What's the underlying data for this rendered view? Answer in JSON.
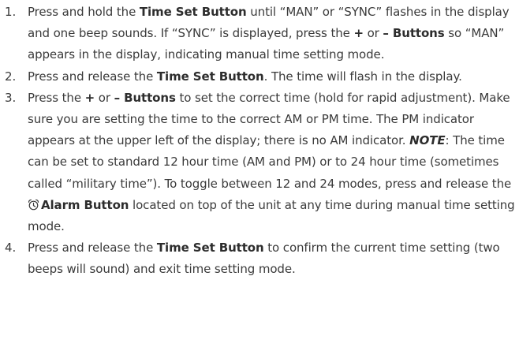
{
  "steps": [
    {
      "number": "1.",
      "parts": [
        "Press and hold the ",
        "Time Set Button",
        " until “MAN” or “SYNC” flashes in the display and one beep sounds. If “SYNC” is displayed, press the ",
        "+",
        " or ",
        "– Buttons",
        " so “MAN” appears in the display, indicating manual time setting mode."
      ]
    },
    {
      "number": "2.",
      "parts": [
        "Press and release the ",
        "Time Set Button",
        ". The time will flash in the display."
      ]
    },
    {
      "number": "3.",
      "parts": [
        "Press the ",
        "+",
        " or ",
        "– Buttons",
        " to set the correct time (hold for rapid adjustment). Make sure you are setting the time to the correct AM or PM time. The PM indicator appears at the upper left of the display; there is no AM indicator.  ",
        "NOTE",
        ": The time can be set to standard 12 hour time (AM and PM) or to 24 hour time (sometimes called “military time”). To toggle between 12 and 24 modes, press and release the ",
        "Alarm Button",
        " located on top of the unit at any time during manual time setting mode."
      ]
    },
    {
      "number": "4.",
      "parts": [
        "Press and release the ",
        "Time Set Button",
        " to confirm the current time setting (two beeps will sound) and exit time setting mode."
      ]
    }
  ],
  "icons": {
    "alarm": "alarm-clock-icon"
  }
}
